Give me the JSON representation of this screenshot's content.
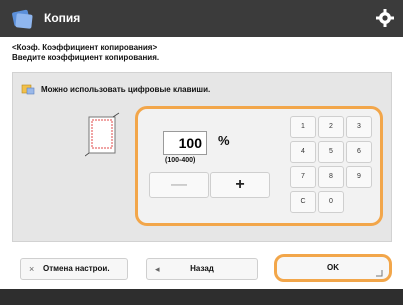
{
  "window": {
    "title": "Копия"
  },
  "breadcrumb": {
    "lines": [
      "<Коэф. Коэффициент копирования>",
      "Введите коэффициент копирования."
    ]
  },
  "mode": {
    "label": "Можно использовать цифровые клавиши."
  },
  "zoom": {
    "value": "100",
    "unit": "%",
    "range": "(100-400)"
  },
  "stepper": {
    "minus": "—",
    "plus": "+"
  },
  "keypad": {
    "keys": [
      "1",
      "2",
      "3",
      "4",
      "5",
      "6",
      "7",
      "8",
      "9",
      "C",
      "0"
    ]
  },
  "footer": {
    "cancel_label": "Отмена настрои.",
    "cancel_icon": "×",
    "back_label": "Назад",
    "back_icon": "◂",
    "ok_label": "OK"
  },
  "colors": {
    "titlebar": "#3b3b3b",
    "accent": "#f2a64a",
    "panel": "#e6e6e6"
  }
}
